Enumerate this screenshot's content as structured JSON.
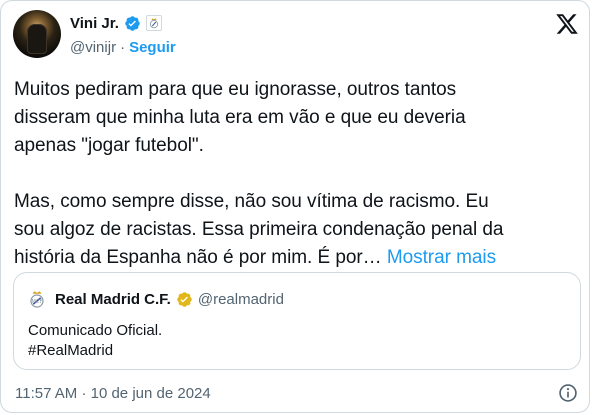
{
  "author": {
    "display_name": "Vini Jr.",
    "handle": "@vinijr",
    "separator": "·",
    "follow_label": "Seguir"
  },
  "tweet": {
    "text": "Muitos pediram para que eu ignorasse, outros tantos\ndisseram que minha luta era em vão e que eu deveria\napenas \"jogar futebol\".\n\nMas, como sempre disse, não sou vítima de racismo. Eu\nsou algoz de racistas. Essa primeira condenação penal da\nhistória da Espanha não é por mim. É por…",
    "show_more_label": "Mostrar mais"
  },
  "quote": {
    "display_name": "Real Madrid C.F.",
    "handle": "@realmadrid",
    "line1": "Comunicado Oficial.",
    "line2": "#RealMadrid"
  },
  "footer": {
    "time": "11:57 AM",
    "separator": "·",
    "date": "10 de jun de 2024"
  },
  "colors": {
    "accent": "#1d9bf0",
    "secondary_text": "#536471",
    "border": "#cfd9de",
    "gold_badge": "#e2b719"
  },
  "icons": {
    "verified": "verified-badge-icon",
    "gold_verified": "gold-verified-badge-icon",
    "club": "real-madrid-crest-icon",
    "brand": "x-logo-icon",
    "info": "info-icon"
  }
}
